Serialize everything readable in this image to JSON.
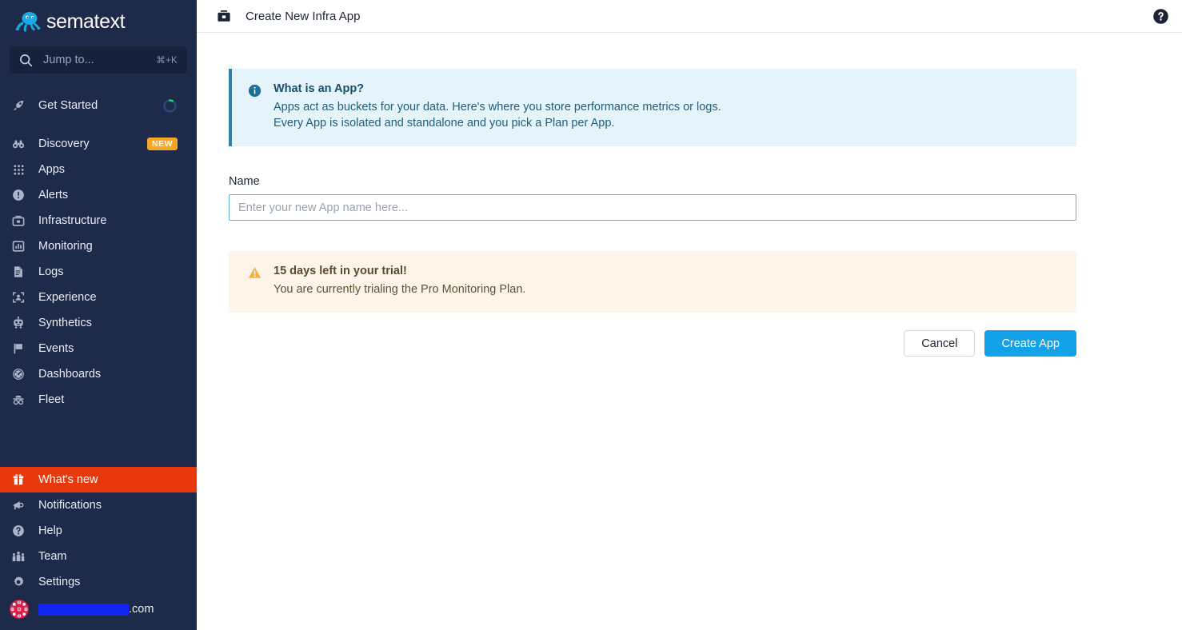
{
  "sidebar": {
    "brand": "sematext",
    "brand_logo_icon": "octopus-logo-icon",
    "search": {
      "placeholder": "Jump to...",
      "shortcut": "⌘+K",
      "icon": "search-icon"
    },
    "items": [
      {
        "label": "Get Started",
        "icon": "rocket-icon",
        "progress_ring": true
      },
      {
        "label": "Discovery",
        "icon": "binoculars-icon",
        "badge": "NEW"
      },
      {
        "label": "Apps",
        "icon": "grid-apps-icon"
      },
      {
        "label": "Alerts",
        "icon": "alert-circle-icon"
      },
      {
        "label": "Infrastructure",
        "icon": "infrastructure-box-icon"
      },
      {
        "label": "Monitoring",
        "icon": "bar-chart-icon"
      },
      {
        "label": "Logs",
        "icon": "document-lines-icon"
      },
      {
        "label": "Experience",
        "icon": "user-frame-icon"
      },
      {
        "label": "Synthetics",
        "icon": "robot-icon"
      },
      {
        "label": "Events",
        "icon": "flag-icon"
      },
      {
        "label": "Dashboards",
        "icon": "gauge-icon"
      },
      {
        "label": "Fleet",
        "icon": "fleet-hat-icon"
      }
    ],
    "bottom_items": [
      {
        "label": "What's new",
        "icon": "gift-icon",
        "active": true
      },
      {
        "label": "Notifications",
        "icon": "megaphone-icon"
      },
      {
        "label": "Help",
        "icon": "help-circle-icon"
      },
      {
        "label": "Team",
        "icon": "team-people-icon"
      },
      {
        "label": "Settings",
        "icon": "gear-icon"
      }
    ],
    "user": {
      "email_suffix": ".com",
      "avatar_icon": "user-avatar-icon",
      "redacted": true
    },
    "colors": {
      "background": "#1e2a4a",
      "active_item": "#e8380d",
      "badge_new": "#f5a623",
      "brand_blue": "#13a1e8"
    }
  },
  "topbar": {
    "title": "Create New Infra App",
    "icon": "infrastructure-box-icon",
    "help_icon": "help-circle-icon"
  },
  "info_banner": {
    "icon": "info-circle-icon",
    "title": "What is an App?",
    "line1": "Apps act as buckets for your data. Here's where you store performance metrics or logs.",
    "line2": "Every App is isolated and standalone and you pick a Plan per App.",
    "accent": "#2f83ab",
    "background": "#e5f3fb"
  },
  "name_field": {
    "label": "Name",
    "value": "",
    "placeholder": "Enter your new App name here...",
    "focused": true,
    "border_color": "#64b0dd"
  },
  "trial_banner": {
    "icon": "warning-triangle-icon",
    "title": "15 days left in your trial!",
    "line1": "You are currently trialing the Pro Monitoring Plan.",
    "background": "#fdf5ea",
    "icon_color": "#f5a623"
  },
  "actions": {
    "cancel_label": "Cancel",
    "create_label": "Create App",
    "create_color": "#13a1e8"
  }
}
